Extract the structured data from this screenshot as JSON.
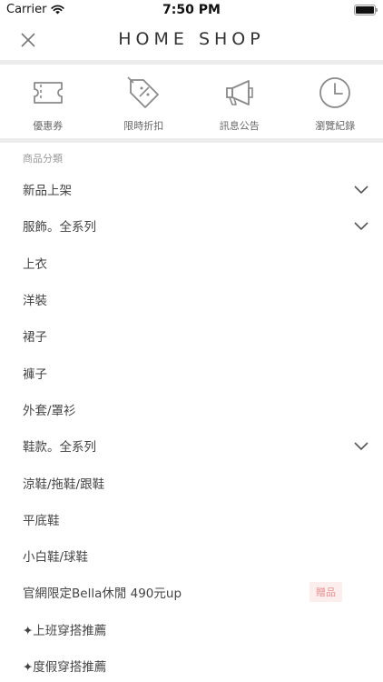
{
  "status_bar": {
    "carrier": "Carrier",
    "time": "7:50 PM"
  },
  "header": {
    "brand": "HOME SHOP",
    "close_icon": "close-icon"
  },
  "shortcuts": [
    {
      "label": "優惠券",
      "icon": "ticket-icon"
    },
    {
      "label": "限時折扣",
      "icon": "discount-tag-icon"
    },
    {
      "label": "訊息公告",
      "icon": "megaphone-icon"
    },
    {
      "label": "瀏覽紀錄",
      "icon": "clock-icon"
    }
  ],
  "section_title": "商品分類",
  "menu": [
    {
      "label": "新品上架",
      "expandable": true
    },
    {
      "label": "服飾。全系列",
      "expandable": true
    },
    {
      "label": "上衣"
    },
    {
      "label": "洋裝"
    },
    {
      "label": "裙子"
    },
    {
      "label": "褲子"
    },
    {
      "label": "外套/罩衫"
    },
    {
      "label": "鞋款。全系列",
      "expandable": true
    },
    {
      "label": "涼鞋/拖鞋/跟鞋"
    },
    {
      "label": "平底鞋"
    },
    {
      "label": "小白鞋/球鞋"
    },
    {
      "label": "官網限定Bella休閒 490元up",
      "badge": "贈品"
    },
    {
      "label": "✦上班穿搭推薦"
    },
    {
      "label": "✦度假穿搭推薦"
    }
  ],
  "colors": {
    "badge_bg": "#fdeeee",
    "badge_text": "#e88f8f",
    "divider": "#ececec",
    "icon_gray": "#8a8a8a"
  }
}
